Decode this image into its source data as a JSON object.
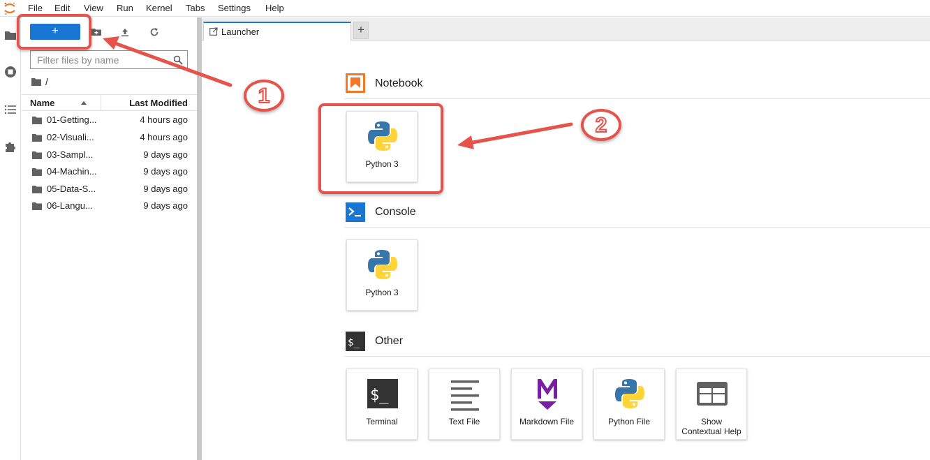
{
  "menubar": {
    "logo_icon": "jupyter-logo-icon",
    "items": [
      "File",
      "Edit",
      "View",
      "Run",
      "Kernel",
      "Tabs",
      "Settings",
      "Help"
    ]
  },
  "activitybar": {
    "icons": [
      "folder-icon",
      "stop-circle-icon",
      "list-icon",
      "puzzle-icon"
    ]
  },
  "filebrowser": {
    "new_label": "+",
    "toolbar_icons": [
      "new-folder-icon",
      "upload-icon",
      "refresh-icon"
    ],
    "filter_placeholder": "Filter files by name",
    "breadcrumb": "/",
    "columns": {
      "name": "Name",
      "modified": "Last Modified"
    },
    "files": [
      {
        "name": "01-Getting...",
        "modified": "4 hours ago"
      },
      {
        "name": "02-Visuali...",
        "modified": "4 hours ago"
      },
      {
        "name": "03-Sampl...",
        "modified": "9 days ago"
      },
      {
        "name": "04-Machin...",
        "modified": "9 days ago"
      },
      {
        "name": "05-Data-S...",
        "modified": "9 days ago"
      },
      {
        "name": "06-Langu...",
        "modified": "9 days ago"
      }
    ]
  },
  "tabs": {
    "active": "Launcher",
    "add_label": "+"
  },
  "launcher": {
    "notebook": {
      "title": "Notebook",
      "cards": [
        "Python 3"
      ]
    },
    "console": {
      "title": "Console",
      "cards": [
        "Python 3"
      ]
    },
    "other": {
      "title": "Other",
      "cards": [
        "Terminal",
        "Text File",
        "Markdown File",
        "Python File",
        "Show Contextual Help"
      ]
    }
  },
  "annotations": {
    "step1": "1",
    "step2": "2",
    "color": "#e5534b"
  },
  "colors": {
    "accent": "#1976d2",
    "notebook_orange": "#f37726",
    "console_blue": "#1976d2",
    "markdown_purple": "#7b1fa2"
  }
}
